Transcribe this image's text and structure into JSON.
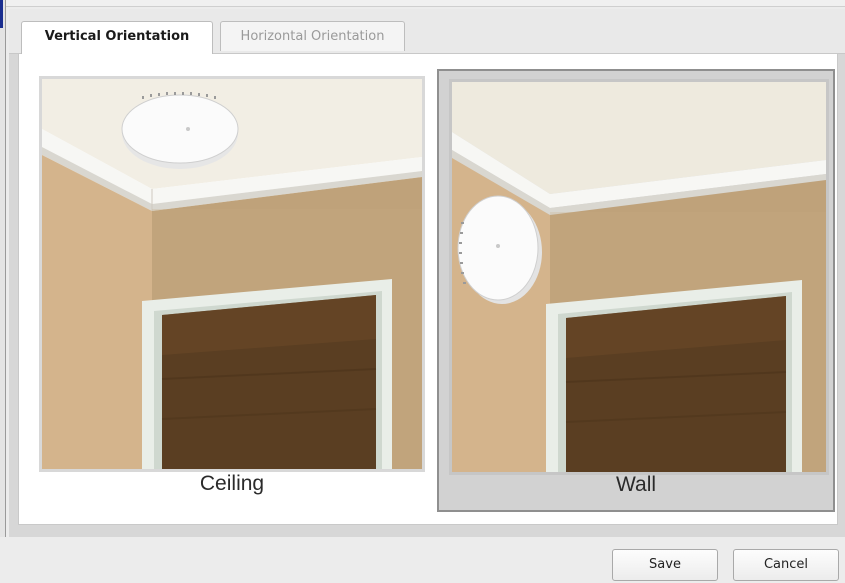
{
  "tabs": [
    {
      "label": "Vertical Orientation",
      "active": true
    },
    {
      "label": "Horizontal Orientation",
      "active": false
    }
  ],
  "options": [
    {
      "label": "Ceiling",
      "selected": false
    },
    {
      "label": "Wall",
      "selected": true
    }
  ],
  "buttons": {
    "save_label": "Save",
    "cancel_label": "Cancel"
  },
  "colors": {
    "selected_bg": "#d2d2d2",
    "selected_border": "#8f8f8f",
    "accent": "#1a2e8f"
  }
}
